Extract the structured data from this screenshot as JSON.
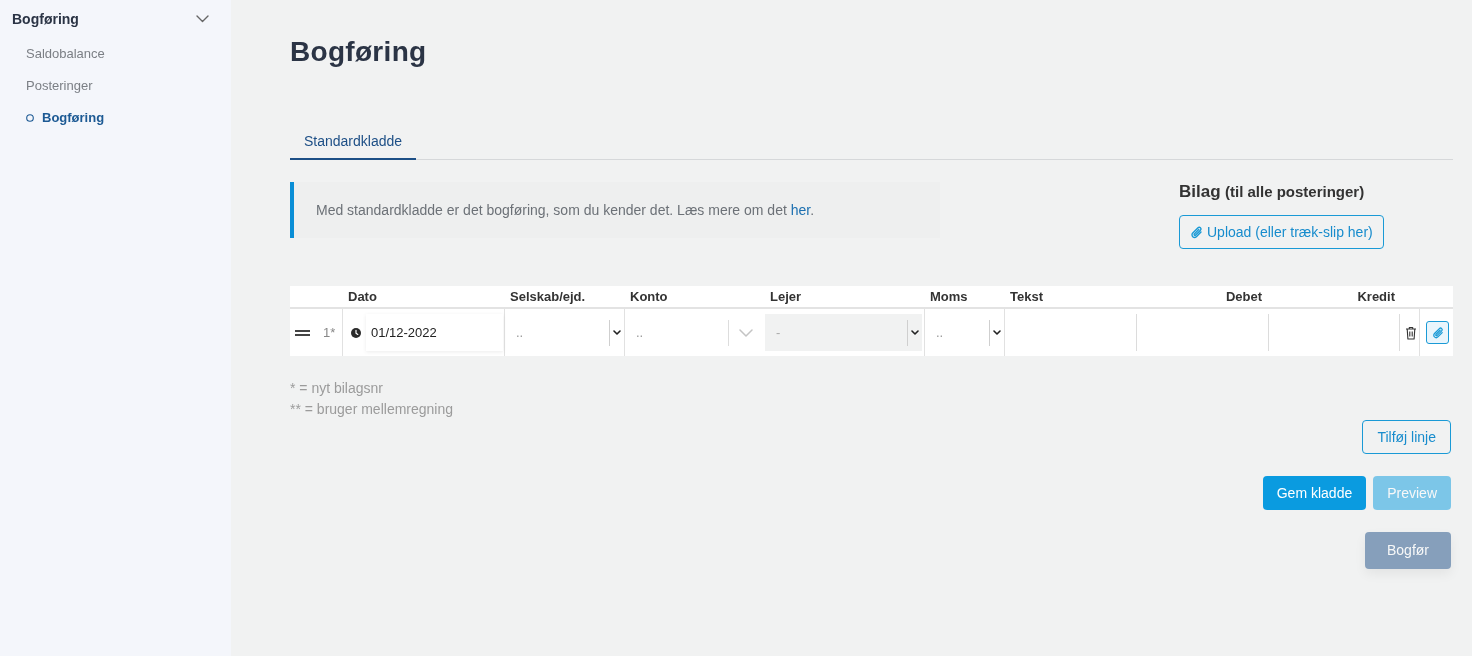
{
  "sidebar": {
    "section": {
      "label": "Bogføring",
      "expanded": true
    },
    "items": [
      {
        "label": "Saldobalance",
        "selected": false
      },
      {
        "label": "Posteringer",
        "selected": false
      },
      {
        "label": "Bogføring",
        "selected": true
      }
    ]
  },
  "page": {
    "title": "Bogføring"
  },
  "tabs": [
    {
      "label": "Standardkladde",
      "selected": true
    }
  ],
  "info": {
    "text": "Med standardkladde er det bogføring, som du kender det. Læs mere om det ",
    "link": "her",
    "text_after": "."
  },
  "attachments": {
    "title": "Bilag",
    "subtitle": "(til alle posteringer)",
    "upload_button": "Upload (eller træk-slip her)"
  },
  "journal": {
    "columns": [
      "Dato",
      "Selskab/ejd.",
      "Konto",
      "Lejer",
      "Moms",
      "Tekst",
      "Debet",
      "Kredit"
    ],
    "rows": [
      {
        "number": "1*",
        "date": "01/12-2022",
        "company": {
          "placeholder": ".."
        },
        "account": {
          "placeholder": ".."
        },
        "tenant": {
          "placeholder": "-",
          "disabled": true
        },
        "vat": {
          "placeholder": ".."
        }
      }
    ]
  },
  "footnotes": [
    "* = nyt bilagsnr",
    "** = bruger mellemregning"
  ],
  "actions": {
    "add_line": {
      "label": "Tilføj linje"
    },
    "save": {
      "label": "Gem kladde"
    },
    "preview": {
      "label": "Preview",
      "disabled": true
    },
    "post": {
      "label": "Bogfør",
      "disabled": true
    }
  }
}
